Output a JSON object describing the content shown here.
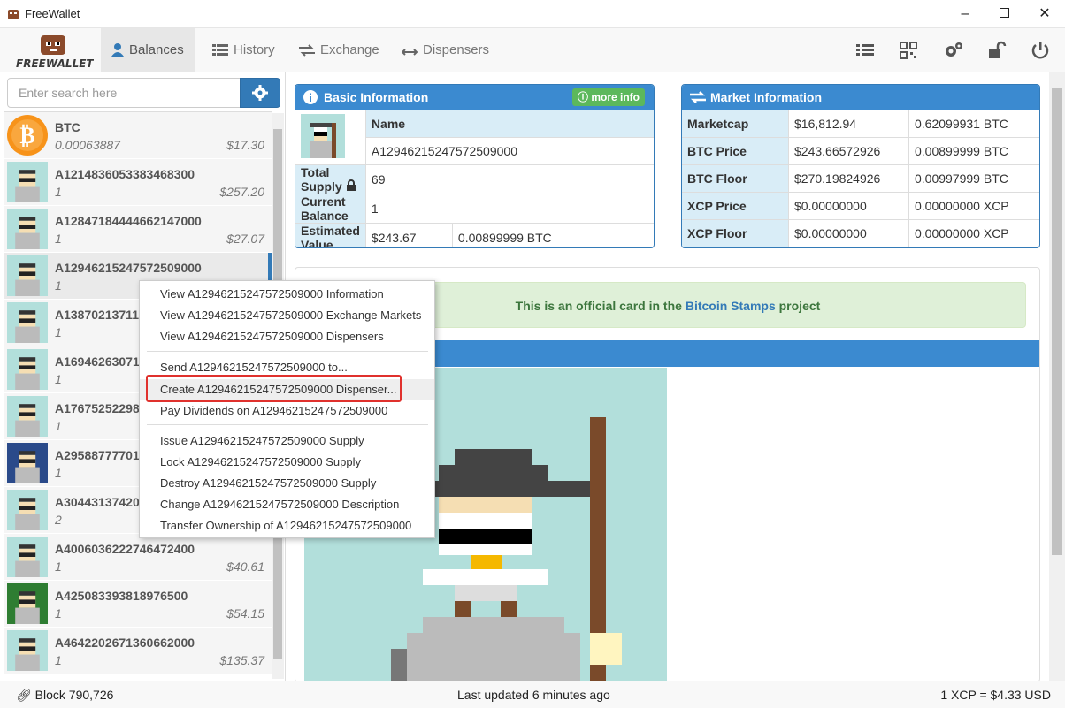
{
  "window": {
    "title": "FreeWallet"
  },
  "nav": {
    "logo_text": "FREEWALLET",
    "tabs": [
      {
        "label": "Balances"
      },
      {
        "label": "History"
      },
      {
        "label": "Exchange"
      },
      {
        "label": "Dispensers"
      }
    ]
  },
  "search": {
    "placeholder": "Enter search here"
  },
  "assets": [
    {
      "name": "BTC",
      "qty": "0.00063887",
      "usd": "$17.30"
    },
    {
      "name": "A1214836053383468300",
      "qty": "1",
      "usd": "$257.20"
    },
    {
      "name": "A12847184444662147000",
      "qty": "1",
      "usd": "$27.07"
    },
    {
      "name": "A12946215247572509000",
      "qty": "1",
      "usd": ""
    },
    {
      "name": "A13870213711",
      "qty": "1",
      "usd": ""
    },
    {
      "name": "A16946263071",
      "qty": "1",
      "usd": ""
    },
    {
      "name": "A17675252298",
      "qty": "1",
      "usd": ""
    },
    {
      "name": "A29588777701",
      "qty": "1",
      "usd": ""
    },
    {
      "name": "A30443137420",
      "qty": "2",
      "usd": ""
    },
    {
      "name": "A4006036222746472400",
      "qty": "1",
      "usd": "$40.61"
    },
    {
      "name": "A425083393818976500",
      "qty": "1",
      "usd": "$54.15"
    },
    {
      "name": "A4642202671360662000",
      "qty": "1",
      "usd": "$135.37"
    }
  ],
  "basic_info": {
    "title": "Basic Information",
    "more_info": "more info",
    "name_label": "Name",
    "name_value": "A12946215247572509000",
    "total_supply_label": "Total Supply",
    "total_supply": "69",
    "current_balance_label": "Current Balance",
    "current_balance": "1",
    "estimated_value_label": "Estimated Value",
    "estimated_usd": "$243.67",
    "estimated_btc": "0.00899999 BTC"
  },
  "market_info": {
    "title": "Market Information",
    "rows": [
      {
        "label": "Marketcap",
        "usd": "$16,812.94",
        "other": "0.62099931 BTC"
      },
      {
        "label": "BTC Price",
        "usd": "$243.66572926",
        "other": "0.00899999 BTC"
      },
      {
        "label": "BTC Floor",
        "usd": "$270.19824926",
        "other": "0.00997999 BTC"
      },
      {
        "label": "XCP Price",
        "usd": "$0.00000000",
        "other": "0.00000000 XCP"
      },
      {
        "label": "XCP Floor",
        "usd": "$0.00000000",
        "other": "0.00000000 XCP"
      }
    ]
  },
  "official": {
    "prefix": "This is an official card in the ",
    "link": "Bitcoin Stamps",
    "suffix": " project"
  },
  "context_menu": {
    "items": [
      "View A12946215247572509000 Information",
      "View A12946215247572509000 Exchange Markets",
      "View A12946215247572509000 Dispensers",
      "Send A12946215247572509000 to...",
      "Create A12946215247572509000 Dispenser...",
      "Pay Dividends on A12946215247572509000",
      "Issue A12946215247572509000 Supply",
      "Lock A12946215247572509000 Supply",
      "Destroy A12946215247572509000 Supply",
      "Change A12946215247572509000 Description",
      "Transfer Ownership of A12946215247572509000"
    ]
  },
  "status": {
    "block": "Block 790,726",
    "updated": "Last updated 6 minutes ago",
    "rate": "1 XCP = $4.33 USD"
  }
}
